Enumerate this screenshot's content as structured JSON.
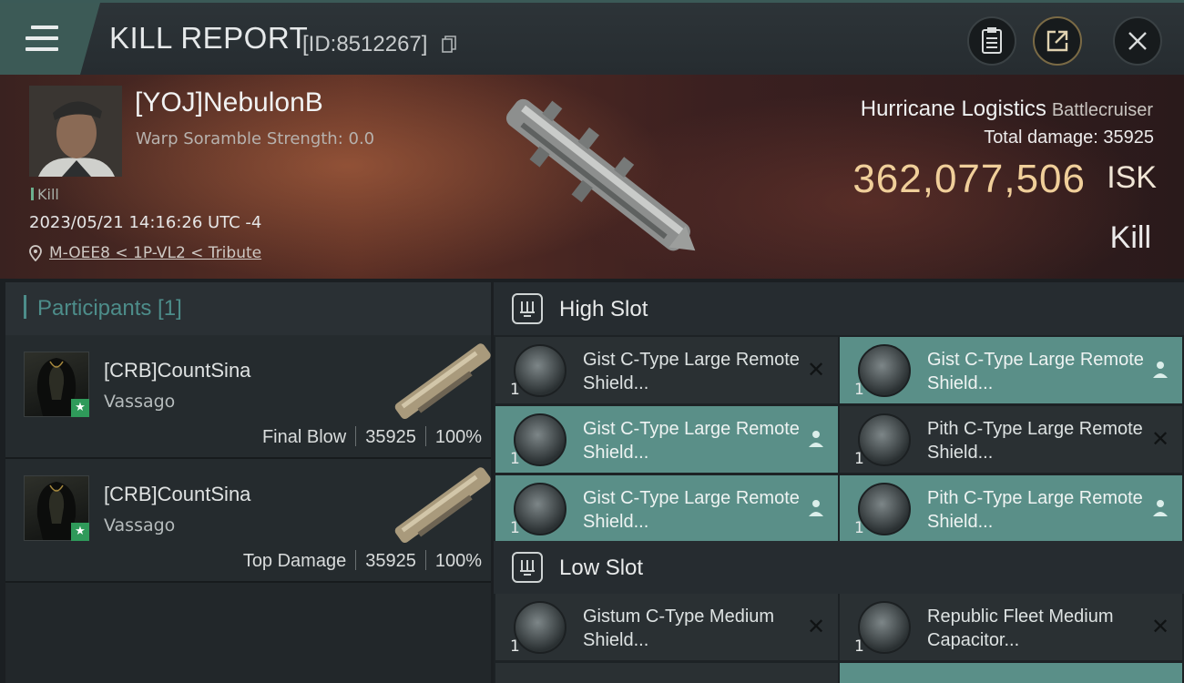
{
  "header": {
    "title": "KILL REPORT",
    "report_id": "[ID:8512267]"
  },
  "victim": {
    "name": "[YOJ]NebulonB",
    "warp_scramble": "Warp Soramble Strength: 0.0",
    "tag": "Kill",
    "time": "2023/05/21 14:16:26 UTC -4",
    "location": "M-OEE8 < 1P-VL2 < Tribute",
    "ship": "Hurricane Logistics",
    "ship_class": "Battlecruiser",
    "total_damage": "Total damage:  35925",
    "isk_value": "362,077,506",
    "isk_unit": "ISK",
    "result": "Kill"
  },
  "participants": {
    "header": "Participants [1]",
    "rows": [
      {
        "name": "[CRB]CountSina",
        "ship": "Vassago",
        "role": "Final Blow",
        "damage": "35925",
        "percent": "100%"
      },
      {
        "name": "[CRB]CountSina",
        "ship": "Vassago",
        "role": "Top Damage",
        "damage": "35925",
        "percent": "100%"
      }
    ]
  },
  "fitting": {
    "high_slot": {
      "title": "High Slot",
      "modules": [
        {
          "name": "Gist C-Type Large Remote Shield...",
          "qty": "1",
          "state": "destroyed"
        },
        {
          "name": "Gist C-Type Large Remote Shield...",
          "qty": "1",
          "state": "dropped"
        },
        {
          "name": "Gist C-Type Large Remote Shield...",
          "qty": "1",
          "state": "dropped"
        },
        {
          "name": "Pith C-Type Large Remote Shield...",
          "qty": "1",
          "state": "destroyed"
        },
        {
          "name": "Gist C-Type Large Remote Shield...",
          "qty": "1",
          "state": "dropped"
        },
        {
          "name": "Pith C-Type Large Remote Shield...",
          "qty": "1",
          "state": "dropped"
        }
      ]
    },
    "low_slot": {
      "title": "Low Slot",
      "modules": [
        {
          "name": "Gistum C-Type Medium Shield...",
          "qty": "1",
          "state": "destroyed"
        },
        {
          "name": "Republic Fleet Medium Capacitor...",
          "qty": "1",
          "state": "destroyed"
        }
      ]
    }
  },
  "colors": {
    "accent": "#4d8d8a",
    "isk": "#f0cf9a",
    "dropped_bg": "#5a8f88"
  }
}
